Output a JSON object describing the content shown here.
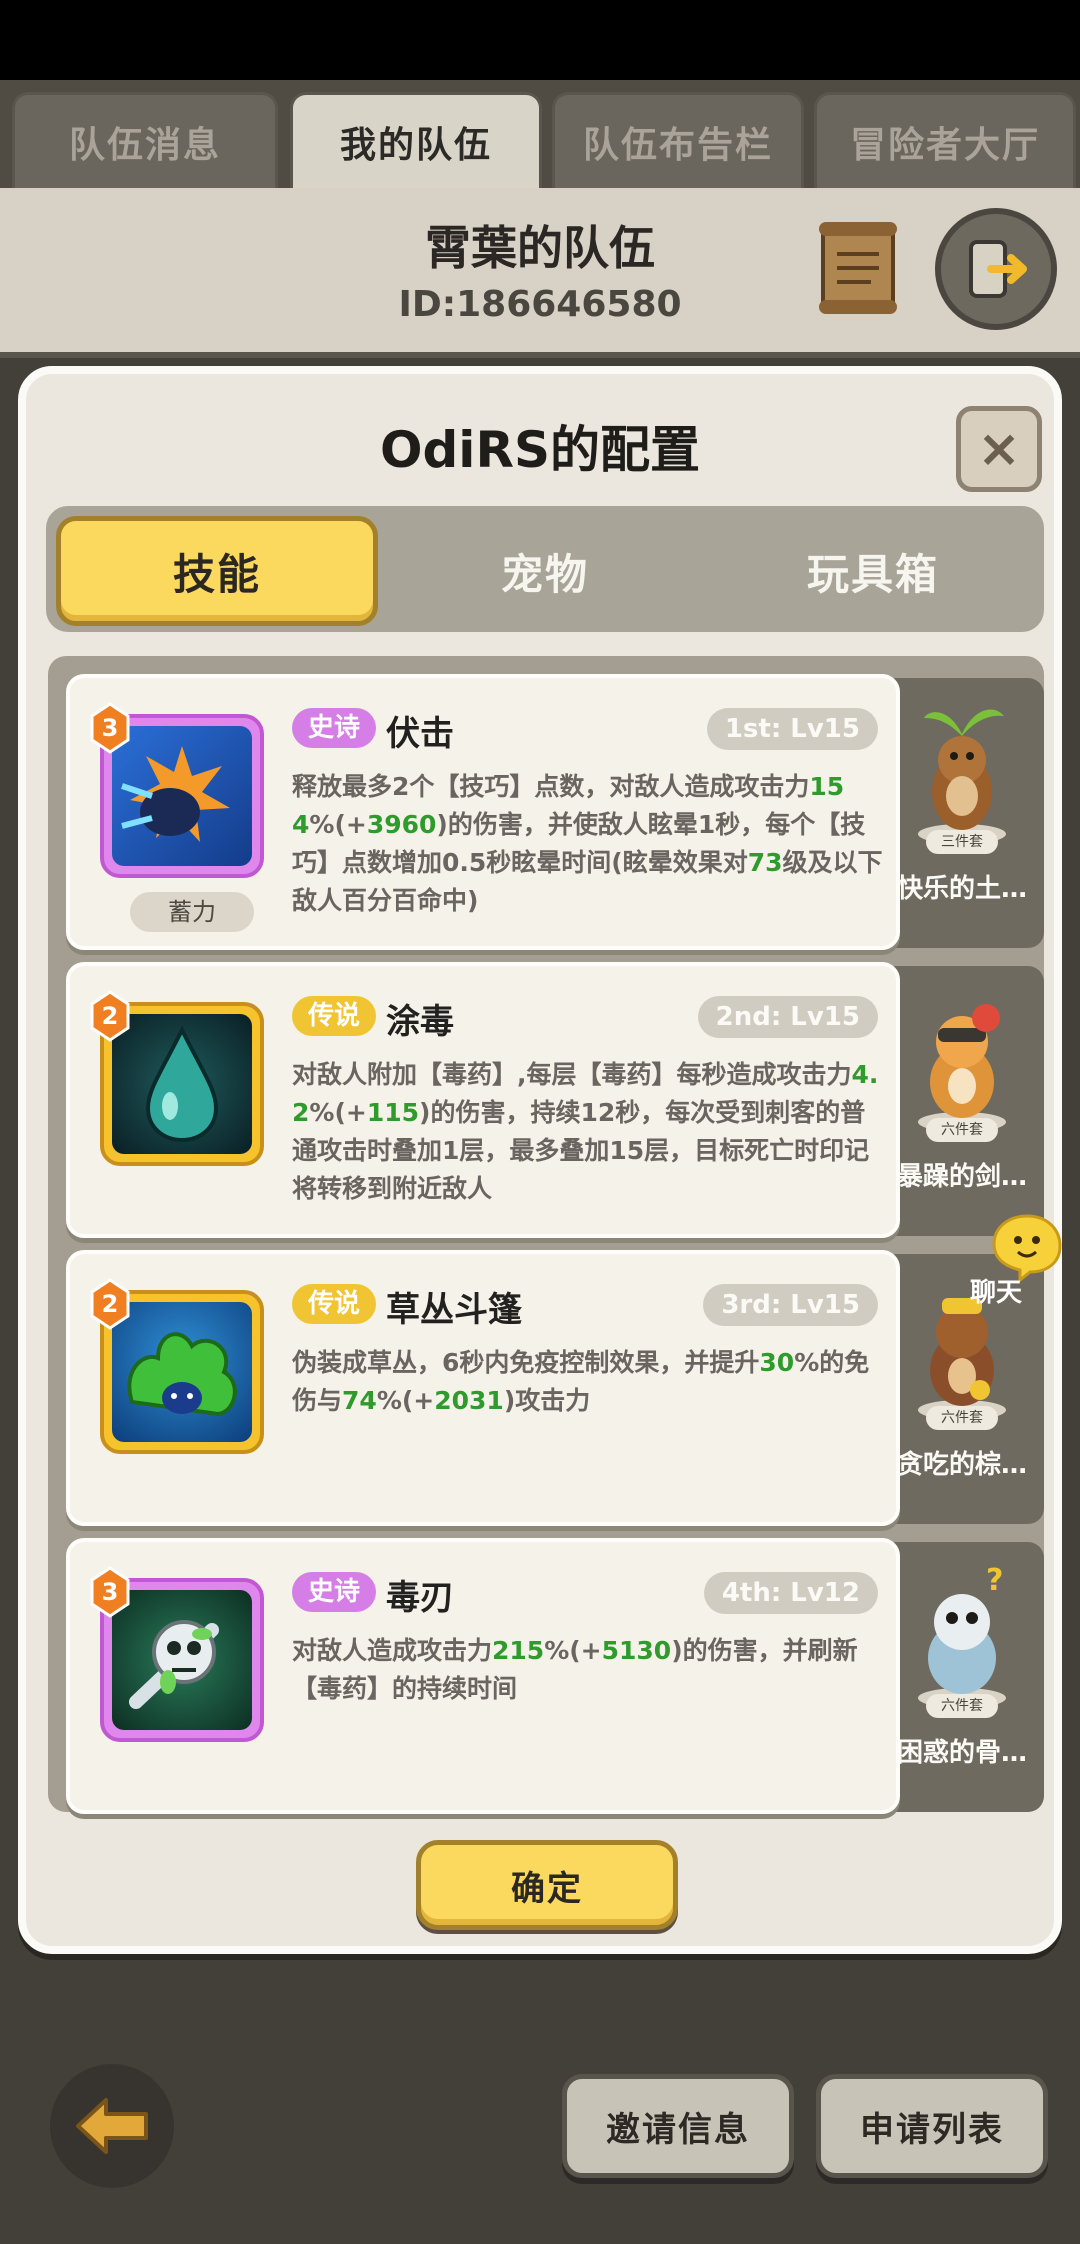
{
  "tabs": [
    {
      "label": "队伍消息",
      "active": false
    },
    {
      "label": "我的队伍",
      "active": true
    },
    {
      "label": "队伍布告栏",
      "active": false
    },
    {
      "label": "冒险者大厅",
      "active": false
    }
  ],
  "team": {
    "name": "霄葉的队伍",
    "id": "ID:186646580"
  },
  "panel": {
    "title": "OdiRS的配置",
    "close_label": "×",
    "segments": [
      {
        "label": "技能",
        "active": true
      },
      {
        "label": "宠物",
        "active": false
      },
      {
        "label": "玩具箱",
        "active": false
      }
    ],
    "confirm_label": "确定"
  },
  "skills": [
    {
      "rarity": "史诗",
      "rarity_type": "epic",
      "name": "伏击",
      "slot": "1st: Lv15",
      "level": "3",
      "tag": "蓄力",
      "desc_parts": [
        {
          "t": "释放最多2个【技巧】点数，对敌人造成攻击力",
          "g": false
        },
        {
          "t": "154",
          "g": true
        },
        {
          "t": "%(+",
          "g": false
        },
        {
          "t": "3960",
          "g": true
        },
        {
          "t": ")的伤害，并使敌人眩晕1秒，每个【技巧】点数增加0.5秒眩晕时间(眩晕效果对",
          "g": false
        },
        {
          "t": "73",
          "g": true
        },
        {
          "t": "级及以下敌人百分百命中)",
          "g": false
        }
      ]
    },
    {
      "rarity": "传说",
      "rarity_type": "legend",
      "name": "涂毒",
      "slot": "2nd: Lv15",
      "level": "2",
      "tag": "",
      "desc_parts": [
        {
          "t": "对敌人附加【毒药】,每层【毒药】每秒造成攻击力",
          "g": false
        },
        {
          "t": "4.2",
          "g": true
        },
        {
          "t": "%(+",
          "g": false
        },
        {
          "t": "115",
          "g": true
        },
        {
          "t": ")的伤害，持续12秒，每次受到刺客的普通攻击时叠加1层，最多叠加15层，目标死亡时印记将转移到附近敌人",
          "g": false
        }
      ]
    },
    {
      "rarity": "传说",
      "rarity_type": "legend",
      "name": "草丛斗篷",
      "slot": "3rd: Lv15",
      "level": "2",
      "tag": "",
      "desc_parts": [
        {
          "t": "伪装成草丛，6秒内免疫控制效果，并提升",
          "g": false
        },
        {
          "t": "30",
          "g": true
        },
        {
          "t": "%的免伤与",
          "g": false
        },
        {
          "t": "74",
          "g": true
        },
        {
          "t": "%(+",
          "g": false
        },
        {
          "t": "2031",
          "g": true
        },
        {
          "t": ")攻击力",
          "g": false
        }
      ]
    },
    {
      "rarity": "史诗",
      "rarity_type": "epic",
      "name": "毒刃",
      "slot": "4th: Lv12",
      "level": "3",
      "tag": "",
      "desc_parts": [
        {
          "t": "对敌人造成攻击力",
          "g": false
        },
        {
          "t": "215",
          "g": true
        },
        {
          "t": "%(+",
          "g": false
        },
        {
          "t": "5130",
          "g": true
        },
        {
          "t": ")的伤害，并刷新【毒药】的持续时间",
          "g": false
        }
      ]
    }
  ],
  "pets": [
    {
      "set": "三件套",
      "name": "快乐的土…"
    },
    {
      "set": "六件套",
      "name": "暴躁的剑…"
    },
    {
      "set": "六件套",
      "name": "贪吃的棕…"
    },
    {
      "set": "六件套",
      "name": "困惑的骨…"
    }
  ],
  "chat": {
    "label": "聊天"
  },
  "bottom": {
    "invite_label": "邀请信息",
    "apply_label": "申请列表"
  }
}
